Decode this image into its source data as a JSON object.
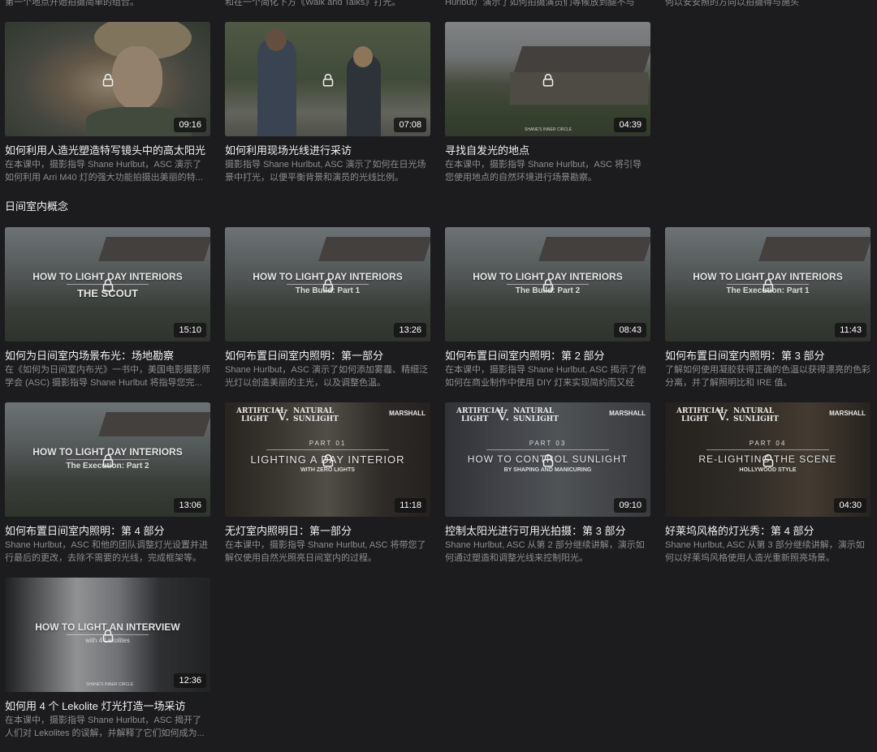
{
  "top_partial": [
    "第一个地点开始拍摄简单的组合。",
    "和在一个简化下方《Walk and Talks》打光。",
    "Hurlbut）演示了如何拍摄演员们等候放到腿不与",
    "何以安安照的方向以拍摄得与施头"
  ],
  "row1": [
    {
      "title": "如何利用人造光塑造特写镜头中的高太阳光",
      "desc": "在本课中，摄影指导 Shane Hurlbut，ASC 演示了如何利用 Arri M40 灯的强大功能拍摄出美丽的特...",
      "duration": "09:16"
    },
    {
      "title": "如何利用现场光线进行采访",
      "desc": "摄影指导 Shane Hurlbut, ASC 演示了如何在日光场景中打光，以便平衡背景和演员的光线比例。",
      "duration": "07:08"
    },
    {
      "title": "寻找自发光的地点",
      "desc": "在本课中，摄影指导 Shane Hurlbut，ASC 将引导您使用地点的自然环境进行场景勘察。",
      "duration": "04:39",
      "watermark": "SHANE'S INNER CIRCLE"
    }
  ],
  "section_title": "日间室内概念",
  "row2": [
    {
      "title": "如何为日间室内场景布光：场地勘察",
      "desc": "在《如何为日间室内布光》一书中，美国电影摄影师学会 (ASC) 摄影指导 Shane Hurlbut 将指导您完...",
      "duration": "15:10",
      "overlay_title": "HOW TO LIGHT DAY INTERIORS",
      "overlay_sub": "THE SCOUT"
    },
    {
      "title": "如何布置日间室内照明：第一部分",
      "desc": "Shane Hurlbut，ASC 演示了如何添加雾霾、精细泛光灯以创造美丽的主光，以及调整色温。",
      "duration": "13:26",
      "overlay_title": "HOW TO LIGHT DAY INTERIORS",
      "overlay_sub": "The Build: Part 1"
    },
    {
      "title": "如何布置日间室内照明：第 2 部分",
      "desc": "在本课中，摄影指导 Shane Hurlbut, ASC 揭示了他如何在商业制作中使用 DIY 灯来实现简约而又经济...",
      "duration": "08:43",
      "overlay_title": "HOW TO LIGHT DAY INTERIORS",
      "overlay_sub": "The Build: Part 2"
    },
    {
      "title": "如何布置日间室内照明：第 3 部分",
      "desc": "了解如何使用凝胶获得正确的色温以获得漂亮的色彩分离，并了解照明比和 IRE 值。",
      "duration": "11:43",
      "overlay_title": "HOW TO LIGHT DAY INTERIORS",
      "overlay_sub": "The Execution: Part 1"
    }
  ],
  "row3": [
    {
      "title": "如何布置日间室内照明：第 4 部分",
      "desc": "Shane Hurlbut，ASC 和他的团队调整灯光设置并进行最后的更改，去除不需要的光线，完成框架等。",
      "duration": "13:06",
      "overlay_title": "HOW TO LIGHT DAY INTERIORS",
      "overlay_sub": "The Execution: Part 2"
    },
    {
      "title": "无灯室内照明日：第一部分",
      "desc": "在本课中，摄影指导 Shane Hurlbut, ASC 将带您了解仅使用自然光照亮日间室内的过程。",
      "duration": "11:18",
      "art_l1": "ARTIFICIAL",
      "art_l2": "LIGHT",
      "vs": "V.",
      "art_r1": "NATURAL",
      "art_r2": "SUNLIGHT",
      "brand": "MARSHALL",
      "part": "PART 01",
      "overlay_title": "LIGHTING A DAY INTERIOR",
      "overlay_sub": "WITH ZERO LIGHTS"
    },
    {
      "title": "控制太阳光进行可用光拍摄：第 3 部分",
      "desc": "Shane Hurlbut, ASC 从第 2 部分继续讲解，演示如何通过塑造和调整光线来控制阳光。",
      "duration": "09:10",
      "art_l1": "ARTIFICIAL",
      "art_l2": "LIGHT",
      "vs": "V.",
      "art_r1": "NATURAL",
      "art_r2": "SUNLIGHT",
      "brand": "MARSHALL",
      "part": "PART 03",
      "overlay_title": "HOW TO CONTROL SUNLIGHT",
      "overlay_sub": "BY SHAPING AND MANICURING"
    },
    {
      "title": "好莱坞风格的灯光秀：第 4 部分",
      "desc": "Shane Hurlbut, ASC 从第 3 部分继续讲解，演示如何以好莱坞风格使用人造光重新照亮场景。",
      "duration": "04:30",
      "art_l1": "ARTIFICIAL",
      "art_l2": "LIGHT",
      "vs": "V.",
      "art_r1": "NATURAL",
      "art_r2": "SUNLIGHT",
      "brand": "MARSHALL",
      "part": "PART 04",
      "overlay_title": "RE-LIGHTING THE SCENE",
      "overlay_sub": "HOLLYWOOD STYLE"
    }
  ],
  "row4": [
    {
      "title": "如何用 4 个 Lekolite 灯光打造一场采访",
      "desc": "在本课中，摄影指导 Shane Hurlbut，ASC 揭开了人们对 Lekolites 的误解，并解释了它们如何成为...",
      "duration": "12:36",
      "overlay_title": "HOW TO LIGHT AN INTERVIEW",
      "overlay_sub": "with 4 Lekolites",
      "watermark": "SHANE'S INNER CIRCLE"
    }
  ]
}
